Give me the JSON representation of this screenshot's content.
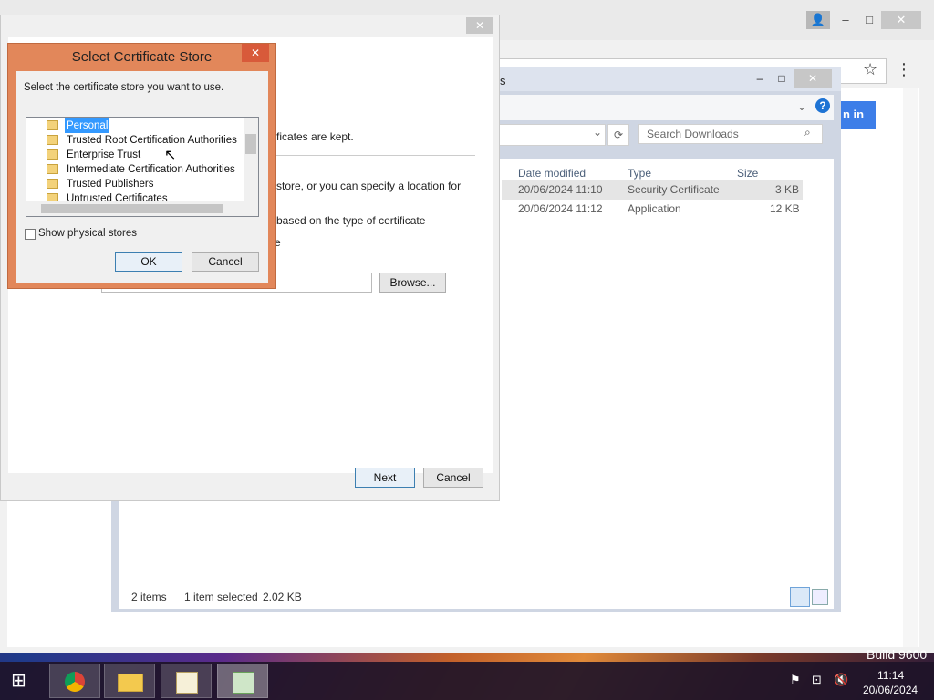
{
  "browser": {
    "bookmark_icon": "star-icon",
    "menu_icon": "three-dots-icon",
    "signin_label": "n in",
    "buttons": {
      "user": "👤",
      "minimize": "–",
      "maximize": "□",
      "close": "✕"
    }
  },
  "explorer": {
    "title": "s",
    "search_placeholder": "Search Downloads",
    "columns": {
      "date": "Date modified",
      "type": "Type",
      "size": "Size"
    },
    "rows": [
      {
        "date": "20/06/2024 11:10",
        "type": "Security Certificate",
        "size": "3 KB"
      },
      {
        "date": "20/06/2024 11:12",
        "type": "Application",
        "size": "12 KB"
      }
    ],
    "status": {
      "items": "2 items",
      "selected": "1 item selected",
      "size": "2.02 KB"
    }
  },
  "wizard": {
    "text1": "ficates are kept.",
    "text2": "store, or you can specify a location for",
    "text3": "based on the type of certificate",
    "text4": "e",
    "browse": "Browse...",
    "next": "Next",
    "cancel": "Cancel"
  },
  "dialog": {
    "title": "Select Certificate Store",
    "instruction": "Select the certificate store you want to use.",
    "stores": [
      "Personal",
      "Trusted Root Certification Authorities",
      "Enterprise Trust",
      "Intermediate Certification Authorities",
      "Trusted Publishers",
      "Untrusted Certificates"
    ],
    "selected": "Personal",
    "show_physical": "Show physical stores",
    "ok": "OK",
    "cancel": "Cancel"
  },
  "desktop": {
    "build": "Build 9600"
  },
  "taskbar": {
    "time": "11:14",
    "date": "20/06/2024"
  }
}
